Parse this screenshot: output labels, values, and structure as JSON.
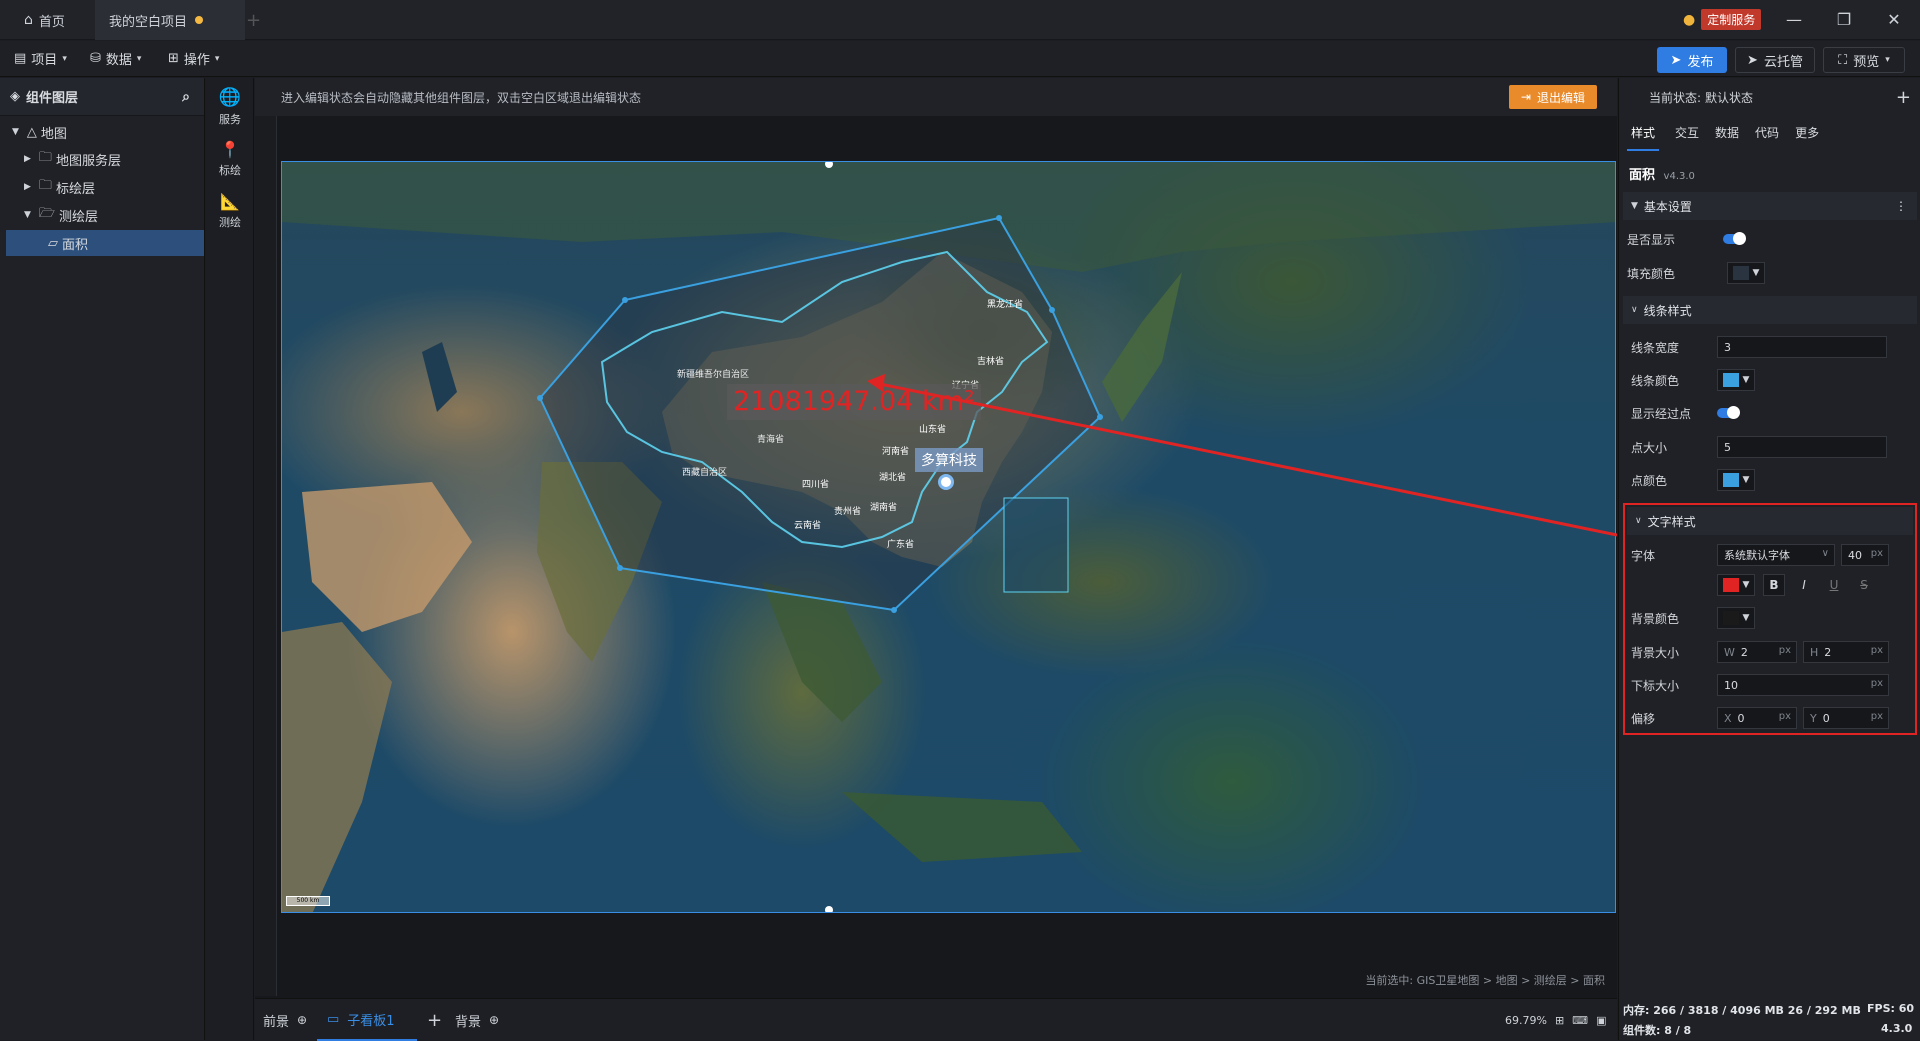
{
  "titlebar": {
    "home_tab": "首页",
    "project_tab": "我的空白项目",
    "custom_service": "定制服务"
  },
  "toolbar": {
    "menu_project": "项目",
    "menu_data": "数据",
    "menu_ops": "操作",
    "publish": "发布",
    "cloud": "云托管",
    "preview": "预览"
  },
  "layers": {
    "title": "组件图层",
    "items": [
      {
        "label": "地图"
      },
      {
        "label": "地图服务层"
      },
      {
        "label": "标绘层"
      },
      {
        "label": "测绘层"
      },
      {
        "label": "面积"
      }
    ]
  },
  "rail": {
    "service": "服务",
    "marker": "标绘",
    "measure": "测绘"
  },
  "stage": {
    "hint": "进入编辑状态会自动隐藏其他组件图层，双击空白区域退出编辑状态",
    "exit_edit": "退出编辑",
    "area_label": "21081947.04 km²",
    "city_label": "多算科技",
    "scale_label": "500 km",
    "provinces": [
      "黑龙江省",
      "吉林省",
      "辽宁省",
      "新疆维吾尔自治区",
      "青海省",
      "西藏自治区",
      "四川省",
      "贵州省",
      "云南省",
      "湖北省",
      "河南省",
      "山东省",
      "湖南省",
      "广东省"
    ],
    "breadcrumb": "当前选中: GIS卫星地图 > 地图 > 测绘层 > 面积"
  },
  "bottombar": {
    "foreground": "前景",
    "subboard": "子看板1",
    "background": "背景",
    "zoom": "69.79%"
  },
  "props": {
    "state_label": "当前状态:",
    "state_value": "默认状态",
    "tabs": [
      "样式",
      "交互",
      "数据",
      "代码",
      "更多"
    ],
    "component_name": "面积",
    "version": "v4.3.0",
    "basic_section": "基本设置",
    "visible_label": "是否显示",
    "fill_label": "填充颜色",
    "line_section": "线条样式",
    "line_width_label": "线条宽度",
    "line_width": "3",
    "line_color_label": "线条颜色",
    "show_points_label": "显示经过点",
    "point_size_label": "点大小",
    "point_size": "5",
    "point_color_label": "点颜色",
    "text_section": "文字样式",
    "font_label": "字体",
    "font_value": "系统默认字体",
    "font_size": "40",
    "bold": "B",
    "italic": "I",
    "underline": "U",
    "strike": "S",
    "bg_color_label": "背景颜色",
    "bg_size_label": "背景大小",
    "w_label": "W",
    "w_value": "2",
    "h_label": "H",
    "h_value": "2",
    "subscript_label": "下标大小",
    "subscript_value": "10",
    "offset_label": "偏移",
    "x_label": "X",
    "x_value": "0",
    "y_label": "Y",
    "y_value": "0",
    "unit_px": "px"
  },
  "status": {
    "memory": "内存:  266 / 3818 / 4096 MB  26 / 292 MB",
    "fps": "FPS:  60",
    "components": "组件数: 8 / 8",
    "version": "4.3.0"
  },
  "colors": {
    "accent": "#2f7ce2",
    "exit": "#e98b2a",
    "area_text": "#e02424",
    "fill": "#2a3340",
    "line": "#3aa0e0",
    "highlight": "#e02424"
  }
}
